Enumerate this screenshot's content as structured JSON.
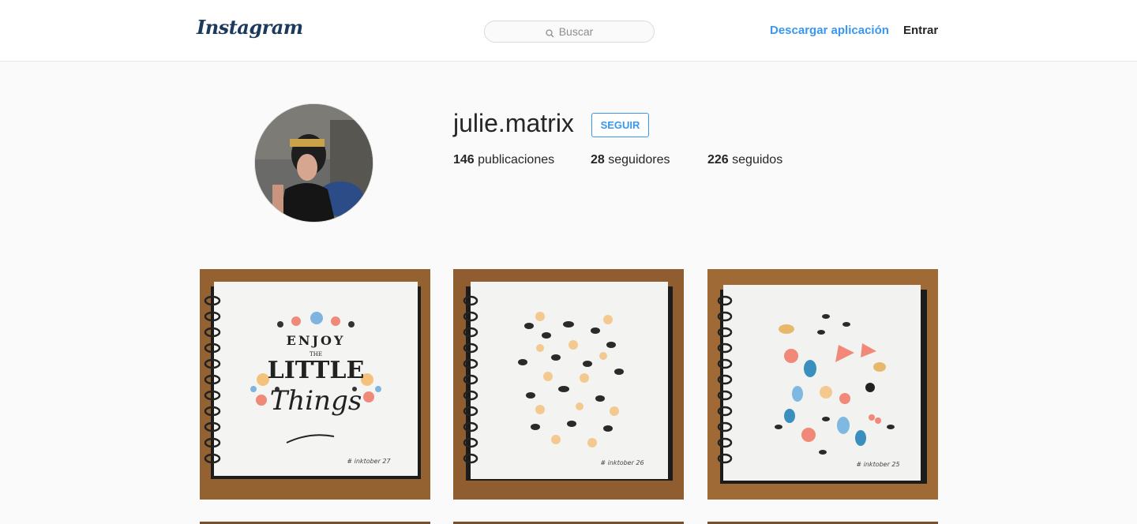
{
  "header": {
    "logo_text": "Instagram",
    "search_placeholder": "Buscar",
    "download_label": "Descargar aplicación",
    "login_label": "Entrar"
  },
  "profile": {
    "username": "julie.matrix",
    "follow_label": "SEGUIR",
    "posts_count": "146",
    "posts_label": "publicaciones",
    "followers_count": "28",
    "followers_label": "seguidores",
    "following_count": "226",
    "following_label": "seguidos"
  },
  "posts": [
    {
      "icon": "sketchbook-lettering-image",
      "caption_lines": [
        "ENJOY",
        "THE",
        "LITTLE",
        "Things"
      ],
      "tag": "# inktober 27"
    },
    {
      "icon": "sketchbook-lemons-image",
      "tag": "# inktober 26"
    },
    {
      "icon": "sketchbook-fruits-image",
      "tag": "# inktober 25"
    }
  ],
  "colors": {
    "link_blue": "#3897f0",
    "logo_navy": "#1b3a5c",
    "background": "#fafafa"
  }
}
